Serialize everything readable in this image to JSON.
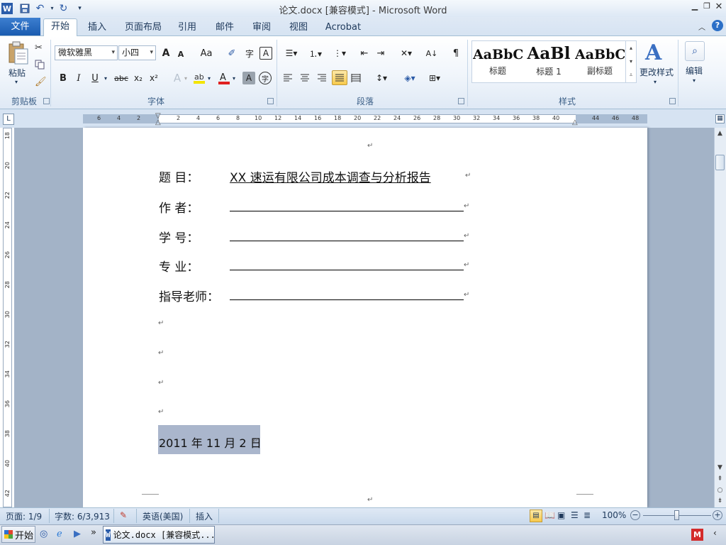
{
  "window": {
    "title": "论文.docx [兼容模式]  -  Microsoft Word",
    "app_letter": "W"
  },
  "tabs": {
    "file": "文件",
    "home": "开始",
    "insert": "插入",
    "page_layout": "页面布局",
    "references": "引用",
    "mailings": "邮件",
    "review": "审阅",
    "view": "视图",
    "acrobat": "Acrobat"
  },
  "ribbon": {
    "clipboard": {
      "paste": "粘贴",
      "label": "剪贴板"
    },
    "font": {
      "name": "微软雅黑",
      "size": "小四",
      "label": "字体",
      "grow": "A",
      "shrink": "A",
      "case": "Aa",
      "bold": "B",
      "italic": "I",
      "underline": "U",
      "strike": "abc",
      "subscript": "x₂",
      "superscript": "x²",
      "font_color": "A",
      "char_shade": "A",
      "enclose": "字"
    },
    "paragraph": {
      "label": "段落"
    },
    "styles": {
      "label": "样式",
      "items": [
        {
          "sample": "AaBbC",
          "name": "标题"
        },
        {
          "sample": "AaBl",
          "name": "标题 1"
        },
        {
          "sample": "AaBbC",
          "name": "副标题"
        }
      ],
      "change": "更改样式"
    },
    "editing": {
      "label": "编辑"
    }
  },
  "ruler": {
    "h_ticks": [
      "6",
      "4",
      "2",
      "",
      "2",
      "4",
      "6",
      "8",
      "10",
      "12",
      "14",
      "16",
      "18",
      "20",
      "22",
      "24",
      "26",
      "28",
      "30",
      "32",
      "34",
      "36",
      "38",
      "40",
      "",
      "44",
      "46",
      "48"
    ],
    "v_ticks": [
      "18",
      "20",
      "22",
      "24",
      "26",
      "28",
      "30",
      "32",
      "34",
      "36",
      "38",
      "40",
      "42"
    ]
  },
  "document": {
    "title_label": "题        目：",
    "title_value": "XX 速运有限公司成本调查与分析报告",
    "author_label": "作        者：",
    "student_id_label": "学        号：",
    "major_label": "专        业：",
    "advisor_label": "指导老师：",
    "date": "2011 年 11 月 2 日",
    "para_mark": "↵"
  },
  "status": {
    "page": "页面: 1/9",
    "words": "字数: 6/3,913",
    "language": "英语(美国)",
    "mode": "插入",
    "zoom": "100%"
  },
  "taskbar": {
    "start": "开始",
    "word_task": "论文.docx [兼容模式..."
  }
}
